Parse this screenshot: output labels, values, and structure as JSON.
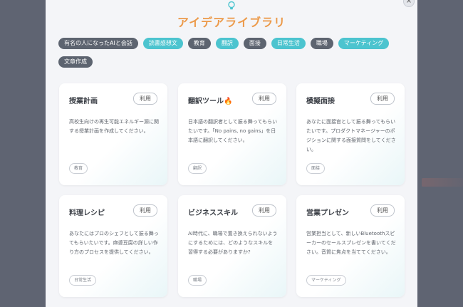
{
  "header": {
    "title": "アイデアライブラリ",
    "icon": "lightbulb-icon",
    "accent": "#ec9a4a"
  },
  "close": {
    "label": "×"
  },
  "tags": [
    {
      "label": "有名の人になったAIと会話",
      "style": "dark"
    },
    {
      "label": "読書感想文",
      "style": "teal"
    },
    {
      "label": "教育",
      "style": "dark"
    },
    {
      "label": "翻訳",
      "style": "teal"
    },
    {
      "label": "面接",
      "style": "dark"
    },
    {
      "label": "日常生活",
      "style": "teal"
    },
    {
      "label": "職場",
      "style": "dark"
    },
    {
      "label": "マーケティング",
      "style": "teal"
    },
    {
      "label": "文章作成",
      "style": "dark"
    }
  ],
  "cards": [
    {
      "title": "授業計画",
      "button": "利用",
      "desc": "高校生向けの再生可能エネルギー源に関する授業計画を作成してください。",
      "tag": "教育"
    },
    {
      "title": "翻訳ツール",
      "emoji": "🔥",
      "button": "利用",
      "desc": "日本語の翻訳者として振る舞ってもらいたいです。「No pains, no gains」を日本語に翻訳してください。",
      "tag": "翻訳"
    },
    {
      "title": "模擬面接",
      "button": "利用",
      "desc": "あなたに面接官として振る舞ってもらいたいです。プロダクトマネージャーのポジションに関する面接質問をしてください。",
      "tag": "面接"
    },
    {
      "title": "料理レシピ",
      "button": "利用",
      "desc": "あなたにはプロのシェフとして振る舞ってもらいたいです。麻婆豆腐の詳しい作り方のプロセスを提供してください。",
      "tag": "日常生活"
    },
    {
      "title": "ビジネススキル",
      "button": "利用",
      "desc": "AI時代に、職場で置き換えられないようにするためには、どのようなスキルを習得する必要がありますか?",
      "tag": "職場"
    },
    {
      "title": "営業プレゼン",
      "button": "利用",
      "desc": "営業担当として、新しいBluetoothスピーカーのセールスプレゼンを書いてください。音質に焦点を当ててください。",
      "tag": "マーケティング"
    }
  ]
}
